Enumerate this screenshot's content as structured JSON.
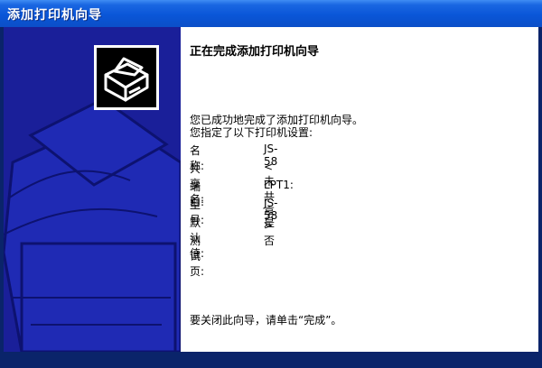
{
  "window": {
    "title": "添加打印机向导"
  },
  "content": {
    "heading": "正在完成添加打印机向导",
    "message_line1": "您已成功地完成了添加打印机向导。",
    "message_line2": "您指定了以下打印机设置:",
    "settings": [
      {
        "label": "名称:",
        "value": "JS-58"
      },
      {
        "label": "共享名:",
        "value": "<未共享>"
      },
      {
        "label": "端口:",
        "value": "LPT1:"
      },
      {
        "label": "型号:",
        "value": "JS-58"
      },
      {
        "label": "默认值:",
        "value": "是"
      },
      {
        "label": "测试页:",
        "value": "否"
      }
    ],
    "footer": "要关闭此向导，请单击“完成”。"
  },
  "icons": {
    "wizard": "printer-icon"
  },
  "colors": {
    "titlebar": "#0b56d8",
    "panel": "#1a1f99",
    "frame": "#0a246a",
    "content_bg": "#ffffff"
  }
}
